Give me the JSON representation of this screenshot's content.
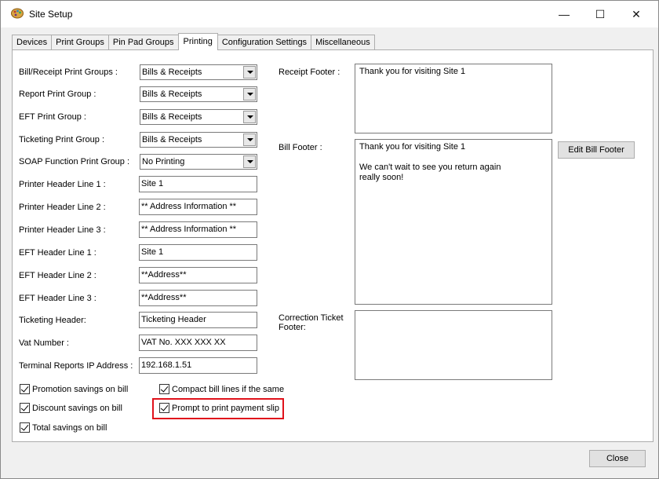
{
  "window": {
    "title": "Site Setup",
    "minimize_glyph": "—",
    "maximize_glyph": "☐",
    "close_glyph": "✕",
    "icon": "paint-palette-icon"
  },
  "tabs": [
    {
      "label": "Devices"
    },
    {
      "label": "Print Groups"
    },
    {
      "label": "Pin Pad Groups"
    },
    {
      "label": "Printing",
      "active": true
    },
    {
      "label": "Configuration Settings"
    },
    {
      "label": "Miscellaneous"
    }
  ],
  "left_fields": [
    {
      "label": "Bill/Receipt Print Groups :",
      "value": "Bills & Receipts",
      "type": "combo"
    },
    {
      "label": "Report Print Group :",
      "value": "Bills & Receipts",
      "type": "combo"
    },
    {
      "label": "EFT Print Group :",
      "value": "Bills & Receipts",
      "type": "combo"
    },
    {
      "label": "Ticketing Print Group :",
      "value": "Bills & Receipts",
      "type": "combo"
    },
    {
      "label": "SOAP Function Print Group :",
      "value": "No Printing",
      "type": "combo"
    },
    {
      "label": "Printer Header Line 1 :",
      "value": "Site 1",
      "type": "text"
    },
    {
      "label": "Printer Header Line 2 :",
      "value": "** Address Information **",
      "type": "text"
    },
    {
      "label": "Printer Header Line 3 :",
      "value": "** Address Information **",
      "type": "text"
    },
    {
      "label": "EFT Header Line 1 :",
      "value": "Site 1",
      "type": "text"
    },
    {
      "label": "EFT Header Line 2 :",
      "value": "**Address**",
      "type": "text"
    },
    {
      "label": "EFT Header Line 3 :",
      "value": "**Address**",
      "type": "text"
    },
    {
      "label": "Ticketing Header:",
      "value": "Ticketing Header",
      "type": "text"
    },
    {
      "label": "Vat Number :",
      "value": "VAT No. XXX XXX XX",
      "type": "text"
    },
    {
      "label": "Terminal Reports IP Address :",
      "value": "192.168.1.51",
      "type": "text"
    }
  ],
  "right_fields": {
    "receipt_footer_label": "Receipt Footer :",
    "receipt_footer_value": "Thank you for visiting Site 1",
    "bill_footer_label": "Bill Footer :",
    "bill_footer_value": "Thank you for visiting Site 1\n\nWe can't wait to see you return again\nreally soon!",
    "edit_bill_footer_button": "Edit Bill Footer",
    "correction_footer_label": "Correction Ticket\nFooter:",
    "correction_footer_value": ""
  },
  "checkboxes": {
    "promotion": {
      "label": "Promotion savings on bill",
      "checked": true
    },
    "discount": {
      "label": "Discount savings on bill",
      "checked": true
    },
    "total": {
      "label": "Total savings on bill",
      "checked": true
    },
    "compact": {
      "label": "Compact bill lines if the same",
      "checked": true
    },
    "prompt_payment_slip": {
      "label": "Prompt to print payment slip",
      "checked": true
    }
  },
  "footer": {
    "close_button": "Close"
  },
  "colors": {
    "highlight": "#e0121b",
    "panel": "#ffffff",
    "window": "#f0f0f0"
  }
}
